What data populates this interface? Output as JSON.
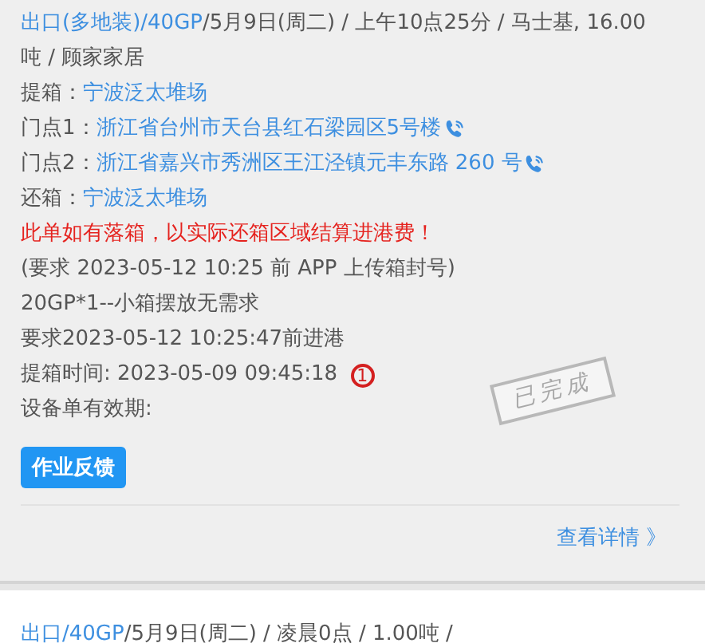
{
  "cards": [
    {
      "header": {
        "link": "出口(多地装)/40GP",
        "rest": "/5月9日(周二) / 上午10点25分 / 马士基, 16.00 吨 / 顾家家居"
      },
      "fields": [
        {
          "label": "提箱：",
          "value": "宁波泛太堆场",
          "phone": false
        },
        {
          "label": "门点1：",
          "value": "浙江省台州市天台县红石梁园区5号楼",
          "phone": true
        },
        {
          "label": "门点2：",
          "value": "浙江省嘉兴市秀洲区王江泾镇元丰东路 260 号",
          "phone": true
        },
        {
          "label": "还箱：",
          "value": "宁波泛太堆场",
          "phone": false
        }
      ],
      "lines": [
        {
          "kind": "warning",
          "text": "此单如有落箱，以实际还箱区域结算进港费！"
        },
        {
          "kind": "plain",
          "text": "(要求 2023-05-12 10:25 前 APP 上传箱封号)"
        },
        {
          "kind": "plain",
          "text": "20GP*1--小箱摆放无需求"
        },
        {
          "kind": "plain",
          "text": "要求2023-05-12 10:25:47前进港"
        },
        {
          "kind": "badge",
          "text": "提箱时间: 2023-05-09 09:45:18",
          "badge": "1"
        },
        {
          "kind": "plain",
          "text": "设备单有效期:"
        }
      ],
      "stamp": "已完成",
      "button": "作业反馈",
      "details_link": "查看详情 》"
    },
    {
      "header": {
        "link": "出口/40GP",
        "rest": "/5月9日(周二) / 凌晨0点 / 1.00吨 /"
      }
    }
  ]
}
